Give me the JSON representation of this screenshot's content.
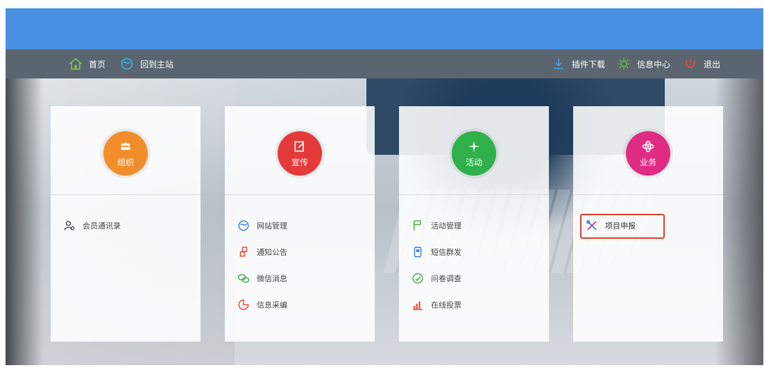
{
  "nav": {
    "left": [
      {
        "label": "首页",
        "icon": "home-icon"
      },
      {
        "label": "回到主站",
        "icon": "globe-icon"
      }
    ],
    "right": [
      {
        "label": "插件下载",
        "icon": "download-icon"
      },
      {
        "label": "信息中心",
        "icon": "gear-icon"
      },
      {
        "label": "退出",
        "icon": "power-icon"
      }
    ]
  },
  "cards": [
    {
      "title": "组织",
      "color": "#f28d2c",
      "items": [
        {
          "label": "会员通讯录",
          "icon": "contacts-icon"
        }
      ]
    },
    {
      "title": "宣传",
      "color": "#e43a3a",
      "items": [
        {
          "label": "网站管理",
          "icon": "globe-icon"
        },
        {
          "label": "通知公告",
          "icon": "bell-icon"
        },
        {
          "label": "微信消息",
          "icon": "wechat-icon"
        },
        {
          "label": "信息采编",
          "icon": "pie-icon"
        }
      ]
    },
    {
      "title": "活动",
      "color": "#2fb04a",
      "items": [
        {
          "label": "活动管理",
          "icon": "flag-icon"
        },
        {
          "label": "短信群发",
          "icon": "phone-icon"
        },
        {
          "label": "问卷调查",
          "icon": "survey-icon"
        },
        {
          "label": "在线投票",
          "icon": "chart-icon"
        }
      ]
    },
    {
      "title": "业务",
      "color": "#e02b83",
      "items": [
        {
          "label": "项目申报",
          "icon": "tools-icon",
          "highlighted": true
        }
      ]
    }
  ]
}
